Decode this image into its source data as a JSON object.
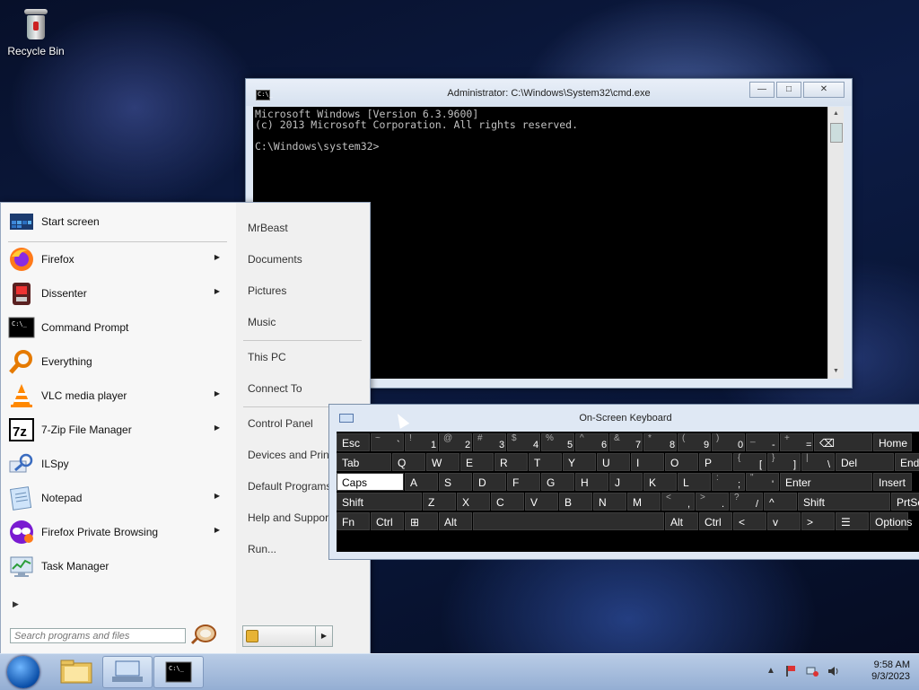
{
  "desktop": {
    "recycle_bin": "Recycle Bin"
  },
  "cmd": {
    "title": "Administrator: C:\\Windows\\System32\\cmd.exe",
    "icon_text": "C:\\_",
    "console_lines": [
      "Microsoft Windows [Version 6.3.9600]",
      "(c) 2013 Microsoft Corporation. All rights reserved.",
      "",
      "C:\\Windows\\system32>"
    ],
    "minimize": "—",
    "maximize": "□",
    "close": "✕"
  },
  "start_menu": {
    "programs": [
      {
        "label": "Start screen",
        "submenu": false
      },
      {
        "label": "Firefox",
        "submenu": true
      },
      {
        "label": "Dissenter",
        "submenu": true
      },
      {
        "label": "Command Prompt",
        "submenu": false
      },
      {
        "label": "Everything",
        "submenu": false
      },
      {
        "label": "VLC media player",
        "submenu": true
      },
      {
        "label": "7-Zip File Manager",
        "submenu": true
      },
      {
        "label": "ILSpy",
        "submenu": false
      },
      {
        "label": "Notepad",
        "submenu": true
      },
      {
        "label": "Firefox Private Browsing",
        "submenu": true
      },
      {
        "label": "Task Manager",
        "submenu": false
      }
    ],
    "submenu_arrow": "▶",
    "all_programs_arrow": "▶",
    "search_placeholder": "Search programs and files",
    "right_links": [
      "MrBeast",
      "Documents",
      "Pictures",
      "Music",
      "This PC",
      "Connect To",
      "Control Panel",
      "Devices and Printers",
      "Default Programs",
      "Help and Support",
      "Run..."
    ],
    "shutdown_arrow": "▶"
  },
  "osk": {
    "title": "On-Screen Keyboard",
    "row1": [
      {
        "m": "Esc"
      },
      {
        "s": "~",
        "b": "`"
      },
      {
        "s": "!",
        "b": "1"
      },
      {
        "s": "@",
        "b": "2"
      },
      {
        "s": "#",
        "b": "3"
      },
      {
        "s": "$",
        "b": "4"
      },
      {
        "s": "%",
        "b": "5"
      },
      {
        "s": "^",
        "b": "6"
      },
      {
        "s": "&",
        "b": "7"
      },
      {
        "s": "*",
        "b": "8"
      },
      {
        "s": "(",
        "b": "9"
      },
      {
        "s": ")",
        "b": "0"
      },
      {
        "s": "_",
        "b": "-"
      },
      {
        "s": "+",
        "b": "="
      },
      {
        "m": "⌫"
      },
      {
        "m": "Home"
      }
    ],
    "row2": [
      {
        "m": "Tab"
      },
      {
        "m": "Q"
      },
      {
        "m": "W"
      },
      {
        "m": "E"
      },
      {
        "m": "R"
      },
      {
        "m": "T"
      },
      {
        "m": "Y"
      },
      {
        "m": "U"
      },
      {
        "m": "I"
      },
      {
        "m": "O"
      },
      {
        "m": "P"
      },
      {
        "s": "{",
        "b": "["
      },
      {
        "s": "}",
        "b": "]"
      },
      {
        "s": "|",
        "b": "\\"
      },
      {
        "m": "Del"
      },
      {
        "m": "End"
      }
    ],
    "row3": [
      {
        "m": "Caps"
      },
      {
        "m": "A"
      },
      {
        "m": "S"
      },
      {
        "m": "D"
      },
      {
        "m": "F"
      },
      {
        "m": "G"
      },
      {
        "m": "H"
      },
      {
        "m": "J"
      },
      {
        "m": "K"
      },
      {
        "m": "L"
      },
      {
        "s": ":",
        "b": ";"
      },
      {
        "s": "\"",
        "b": "'"
      },
      {
        "m": "Enter"
      },
      {
        "m": "Insert"
      }
    ],
    "row4": [
      {
        "m": "Shift"
      },
      {
        "m": "Z"
      },
      {
        "m": "X"
      },
      {
        "m": "C"
      },
      {
        "m": "V"
      },
      {
        "m": "B"
      },
      {
        "m": "N"
      },
      {
        "m": "M"
      },
      {
        "s": "<",
        "b": ","
      },
      {
        "s": ">",
        "b": "."
      },
      {
        "s": "?",
        "b": "/"
      },
      {
        "m": "^"
      },
      {
        "m": "Shift"
      },
      {
        "m": "PrtScn"
      }
    ],
    "row5": [
      {
        "m": "Fn"
      },
      {
        "m": "Ctrl"
      },
      {
        "m": "⊞"
      },
      {
        "m": "Alt"
      },
      {
        "m": ""
      },
      {
        "m": "Alt"
      },
      {
        "m": "Ctrl"
      },
      {
        "m": "<"
      },
      {
        "m": "v"
      },
      {
        "m": ">"
      },
      {
        "m": "☰"
      },
      {
        "m": "Options"
      }
    ]
  },
  "taskbar": {
    "time": "9:58 AM",
    "date": "9/3/2023",
    "tray_arrow": "▲"
  }
}
